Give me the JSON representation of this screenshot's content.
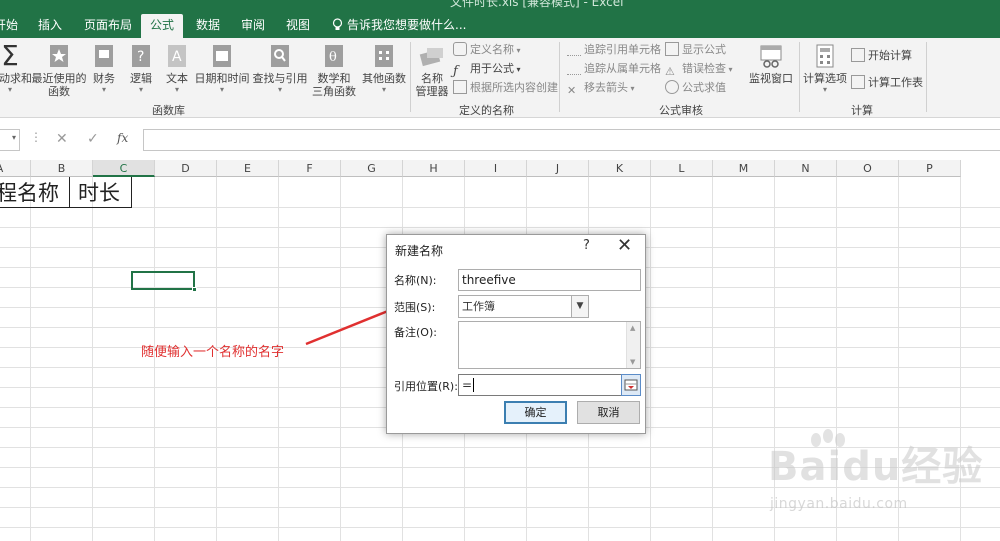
{
  "window": {
    "title": "文件时长.xls [兼容模式] - Excel",
    "minimize_glyph": "—"
  },
  "tabs": [
    "开始",
    "插入",
    "页面布局",
    "公式",
    "数据",
    "审阅",
    "视图"
  ],
  "active_tab": "公式",
  "tell_me": "告诉我您想要做什么...",
  "ribbon": {
    "function_library": {
      "label": "函数库",
      "buttons": [
        {
          "line1": "自动求和",
          "line2": "",
          "icon": "sigma-icon"
        },
        {
          "line1": "最近使用的",
          "line2": "函数",
          "icon": "star-icon"
        },
        {
          "line1": "财务",
          "line2": "",
          "icon": "finance-book-icon"
        },
        {
          "line1": "逻辑",
          "line2": "",
          "icon": "logic-book-icon"
        },
        {
          "line1": "文本",
          "line2": "",
          "icon": "text-book-icon"
        },
        {
          "line1": "日期和时间",
          "line2": "",
          "icon": "datetime-book-icon"
        },
        {
          "line1": "查找与引用",
          "line2": "",
          "icon": "lookup-book-icon"
        },
        {
          "line1": "数学和",
          "line2": "三角函数",
          "icon": "math-book-icon"
        },
        {
          "line1": "其他函数",
          "line2": "",
          "icon": "more-functions-icon"
        }
      ]
    },
    "defined_names": {
      "label": "定义的名称",
      "name_manager": {
        "line1": "名称",
        "line2": "管理器"
      },
      "define_name": "定义名称",
      "use_in_formula": "用于公式",
      "create_from_selection": "根据所选内容创建"
    },
    "formula_auditing": {
      "label": "公式审核",
      "trace_precedents": "追踪引用单元格",
      "trace_dependents": "追踪从属单元格",
      "remove_arrows": "移去箭头",
      "show_formulas": "显示公式",
      "error_checking": "错误检查",
      "evaluate_formula": "公式求值",
      "watch_window": "监视窗口"
    },
    "calculation": {
      "label": "计算",
      "calc_options": "计算选项",
      "calc_now": "开始计算",
      "calc_sheet": "计算工作表"
    }
  },
  "formula_bar": {
    "cancel": "✕",
    "enter": "✓",
    "fx": "fx",
    "value": ""
  },
  "columns": [
    "A",
    "B",
    "C",
    "D",
    "E",
    "F",
    "G",
    "H",
    "I",
    "J",
    "K",
    "L",
    "M",
    "N",
    "O",
    "P"
  ],
  "selected_column": "C",
  "cells": {
    "A1": "程名称",
    "B1": "时长"
  },
  "annotation": "随便输入一个名称的名字",
  "dialog": {
    "title": "新建名称",
    "help": "?",
    "close": "✕",
    "name_label": "名称(N):",
    "name_value": "threefive",
    "scope_label": "范围(S):",
    "scope_value": "工作簿",
    "comment_label": "备注(O):",
    "comment_value": "",
    "refers_to_label": "引用位置(R):",
    "refers_to_value": "=",
    "ok": "确定",
    "cancel": "取消"
  },
  "watermark": {
    "brand": "Baidu经验",
    "url": "jingyan.baidu.com"
  },
  "colors": {
    "excel_green": "#217346",
    "annotation_red": "#e03030",
    "dialog_accent": "#3c7fb1"
  }
}
